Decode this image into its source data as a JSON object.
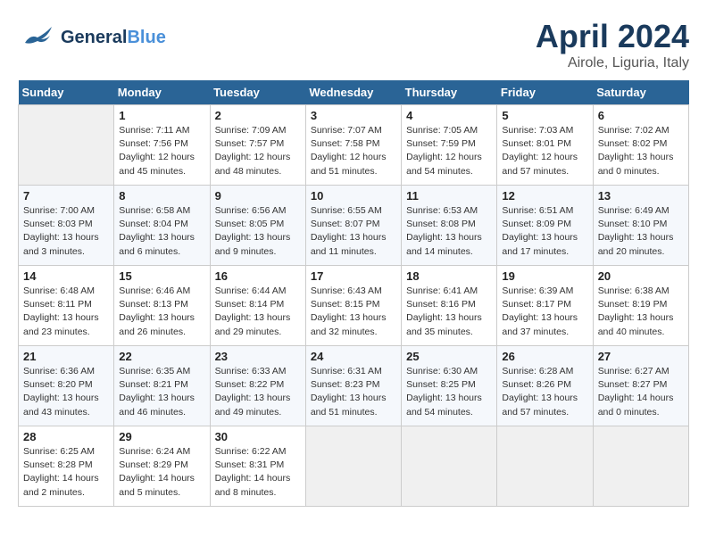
{
  "header": {
    "logo_general": "General",
    "logo_blue": "Blue",
    "month_year": "April 2024",
    "location": "Airole, Liguria, Italy"
  },
  "days_of_week": [
    "Sunday",
    "Monday",
    "Tuesday",
    "Wednesday",
    "Thursday",
    "Friday",
    "Saturday"
  ],
  "weeks": [
    [
      {
        "day": "",
        "empty": true
      },
      {
        "day": "1",
        "sunrise": "7:11 AM",
        "sunset": "7:56 PM",
        "daylight": "12 hours and 45 minutes."
      },
      {
        "day": "2",
        "sunrise": "7:09 AM",
        "sunset": "7:57 PM",
        "daylight": "12 hours and 48 minutes."
      },
      {
        "day": "3",
        "sunrise": "7:07 AM",
        "sunset": "7:58 PM",
        "daylight": "12 hours and 51 minutes."
      },
      {
        "day": "4",
        "sunrise": "7:05 AM",
        "sunset": "7:59 PM",
        "daylight": "12 hours and 54 minutes."
      },
      {
        "day": "5",
        "sunrise": "7:03 AM",
        "sunset": "8:01 PM",
        "daylight": "12 hours and 57 minutes."
      },
      {
        "day": "6",
        "sunrise": "7:02 AM",
        "sunset": "8:02 PM",
        "daylight": "13 hours and 0 minutes."
      }
    ],
    [
      {
        "day": "7",
        "sunrise": "7:00 AM",
        "sunset": "8:03 PM",
        "daylight": "13 hours and 3 minutes."
      },
      {
        "day": "8",
        "sunrise": "6:58 AM",
        "sunset": "8:04 PM",
        "daylight": "13 hours and 6 minutes."
      },
      {
        "day": "9",
        "sunrise": "6:56 AM",
        "sunset": "8:05 PM",
        "daylight": "13 hours and 9 minutes."
      },
      {
        "day": "10",
        "sunrise": "6:55 AM",
        "sunset": "8:07 PM",
        "daylight": "13 hours and 11 minutes."
      },
      {
        "day": "11",
        "sunrise": "6:53 AM",
        "sunset": "8:08 PM",
        "daylight": "13 hours and 14 minutes."
      },
      {
        "day": "12",
        "sunrise": "6:51 AM",
        "sunset": "8:09 PM",
        "daylight": "13 hours and 17 minutes."
      },
      {
        "day": "13",
        "sunrise": "6:49 AM",
        "sunset": "8:10 PM",
        "daylight": "13 hours and 20 minutes."
      }
    ],
    [
      {
        "day": "14",
        "sunrise": "6:48 AM",
        "sunset": "8:11 PM",
        "daylight": "13 hours and 23 minutes."
      },
      {
        "day": "15",
        "sunrise": "6:46 AM",
        "sunset": "8:13 PM",
        "daylight": "13 hours and 26 minutes."
      },
      {
        "day": "16",
        "sunrise": "6:44 AM",
        "sunset": "8:14 PM",
        "daylight": "13 hours and 29 minutes."
      },
      {
        "day": "17",
        "sunrise": "6:43 AM",
        "sunset": "8:15 PM",
        "daylight": "13 hours and 32 minutes."
      },
      {
        "day": "18",
        "sunrise": "6:41 AM",
        "sunset": "8:16 PM",
        "daylight": "13 hours and 35 minutes."
      },
      {
        "day": "19",
        "sunrise": "6:39 AM",
        "sunset": "8:17 PM",
        "daylight": "13 hours and 37 minutes."
      },
      {
        "day": "20",
        "sunrise": "6:38 AM",
        "sunset": "8:19 PM",
        "daylight": "13 hours and 40 minutes."
      }
    ],
    [
      {
        "day": "21",
        "sunrise": "6:36 AM",
        "sunset": "8:20 PM",
        "daylight": "13 hours and 43 minutes."
      },
      {
        "day": "22",
        "sunrise": "6:35 AM",
        "sunset": "8:21 PM",
        "daylight": "13 hours and 46 minutes."
      },
      {
        "day": "23",
        "sunrise": "6:33 AM",
        "sunset": "8:22 PM",
        "daylight": "13 hours and 49 minutes."
      },
      {
        "day": "24",
        "sunrise": "6:31 AM",
        "sunset": "8:23 PM",
        "daylight": "13 hours and 51 minutes."
      },
      {
        "day": "25",
        "sunrise": "6:30 AM",
        "sunset": "8:25 PM",
        "daylight": "13 hours and 54 minutes."
      },
      {
        "day": "26",
        "sunrise": "6:28 AM",
        "sunset": "8:26 PM",
        "daylight": "13 hours and 57 minutes."
      },
      {
        "day": "27",
        "sunrise": "6:27 AM",
        "sunset": "8:27 PM",
        "daylight": "14 hours and 0 minutes."
      }
    ],
    [
      {
        "day": "28",
        "sunrise": "6:25 AM",
        "sunset": "8:28 PM",
        "daylight": "14 hours and 2 minutes."
      },
      {
        "day": "29",
        "sunrise": "6:24 AM",
        "sunset": "8:29 PM",
        "daylight": "14 hours and 5 minutes."
      },
      {
        "day": "30",
        "sunrise": "6:22 AM",
        "sunset": "8:31 PM",
        "daylight": "14 hours and 8 minutes."
      },
      {
        "day": "",
        "empty": true
      },
      {
        "day": "",
        "empty": true
      },
      {
        "day": "",
        "empty": true
      },
      {
        "day": "",
        "empty": true
      }
    ]
  ],
  "labels": {
    "sunrise_prefix": "Sunrise: ",
    "sunset_prefix": "Sunset: ",
    "daylight_prefix": "Daylight: "
  }
}
